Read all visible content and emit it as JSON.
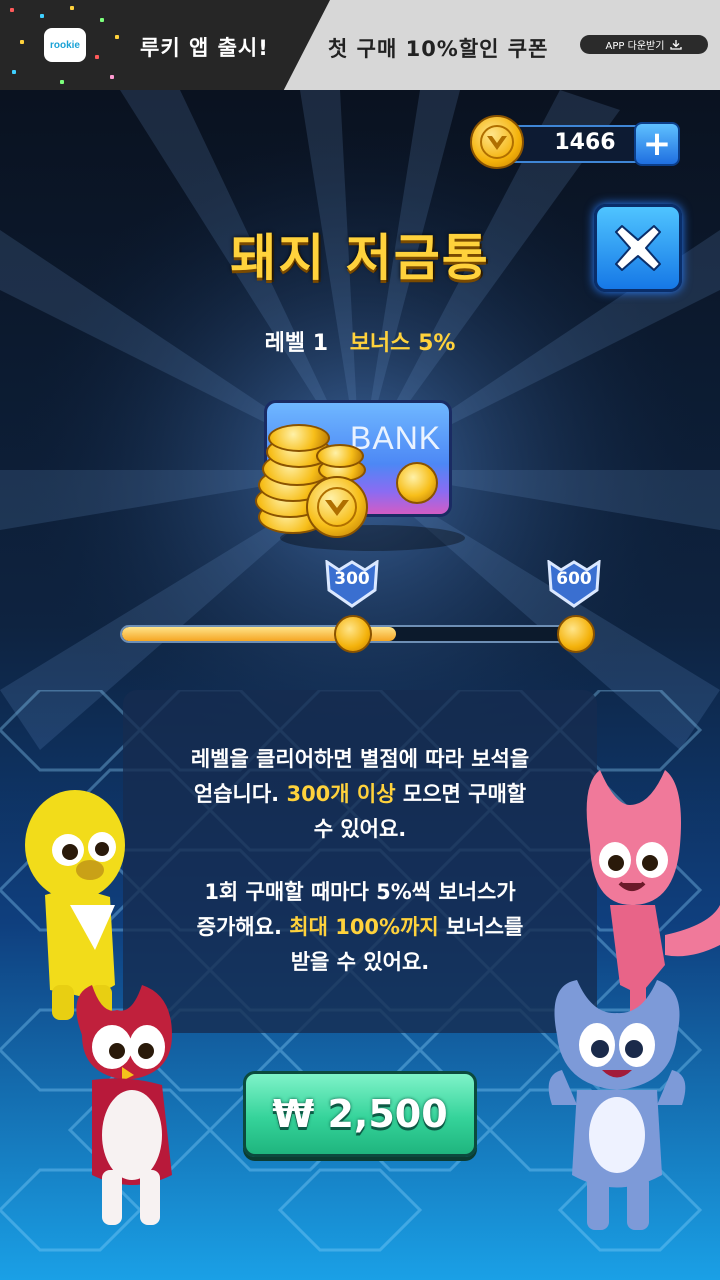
{
  "ad": {
    "logo_text": "rookie",
    "title": "루키 앱 출시!",
    "coupon": "첫 구매 10%할인 쿠폰",
    "download_label": "APP 다운받기"
  },
  "wallet": {
    "coins": "1466",
    "plus_symbol": "+"
  },
  "popup": {
    "title": "돼지 저금통",
    "level": "레벨 1",
    "bonus": "보너스 5%",
    "bank_label": "BANK"
  },
  "progress": {
    "value": 0.6,
    "milestones": [
      {
        "label": "300"
      },
      {
        "label": "600"
      }
    ]
  },
  "info": {
    "p1_line1": "레벨을 클리어하면 별점에 따라 보석을",
    "p1_line2_a": "얻습니다. ",
    "p1_line2_hl": "300개 이상",
    "p1_line2_b": " 모으면 구매할",
    "p1_line3": "수 있어요.",
    "p2_line1": "1회 구매할 때마다 5%씩 보너스가",
    "p2_line2_a": "증가해요. ",
    "p2_line2_hl": "최대 100%까지",
    "p2_line2_b": " 보너스를",
    "p2_line3": "받을 수 있어요."
  },
  "purchase": {
    "price_label": "₩ 2,500"
  },
  "colors": {
    "accent_gold": "#ffd23c",
    "button_green": "#35d39a",
    "button_blue": "#1f6fe0"
  },
  "icons": [
    "coin-icon",
    "plus-icon",
    "close-icon",
    "download-icon",
    "piggy-bank-icon",
    "milestone-badge-icon"
  ]
}
